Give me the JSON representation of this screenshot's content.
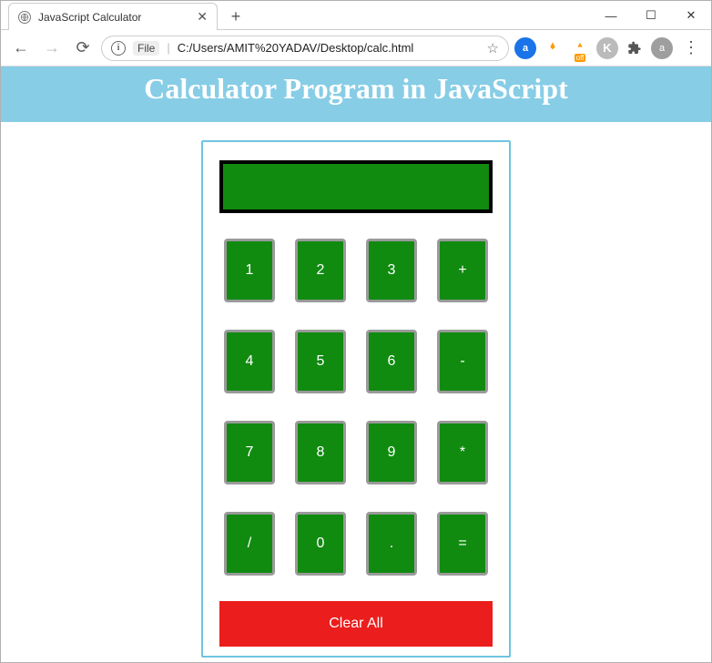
{
  "window": {
    "tab_title": "JavaScript Calculator",
    "new_tab_glyph": "+",
    "minimize_glyph": "—",
    "maximize_glyph": "☐",
    "close_glyph": "✕"
  },
  "toolbar": {
    "back_glyph": "←",
    "forward_glyph": "→",
    "reload_glyph": "⟳",
    "info_glyph": "i",
    "file_label": "File",
    "url_divider": "|",
    "url": "C:/Users/AMIT%20YADAV/Desktop/calc.html",
    "star_glyph": "☆",
    "ext_a_label": "a",
    "ext_off_badge": "off",
    "ext_k_label": "K",
    "avatar_label": "a",
    "menu_glyph": "⋮"
  },
  "page": {
    "heading": "Calculator Program in JavaScript",
    "display_value": "",
    "keys": [
      "1",
      "2",
      "3",
      "+",
      "4",
      "5",
      "6",
      "-",
      "7",
      "8",
      "9",
      "*",
      "/",
      "0",
      ".",
      "="
    ],
    "clear_label": "Clear All"
  }
}
